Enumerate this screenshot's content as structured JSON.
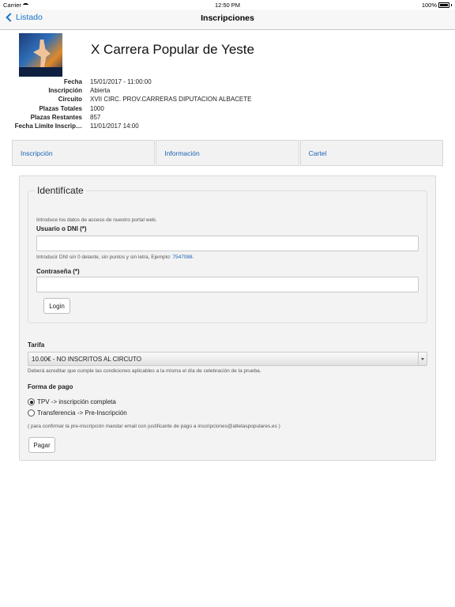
{
  "status_bar": {
    "carrier": "Carrier",
    "time": "12:50 PM",
    "battery": "100%",
    "battery_level": 1.0
  },
  "nav": {
    "back_label": "Listado",
    "title": "Inscripciones"
  },
  "race": {
    "title": "X Carrera Popular de Yeste",
    "details": [
      {
        "key": "Fecha",
        "value": "15/01/2017 - 11:00:00"
      },
      {
        "key": "Inscripción",
        "value": "Abierta"
      },
      {
        "key": "Circuito",
        "value": "XVII CIRC. PROV.CARRERAS DIPUTACION ALBACETE"
      },
      {
        "key": "Plazas Totales",
        "value": "1000"
      },
      {
        "key": "Plazas Restantes",
        "value": "857"
      },
      {
        "key": "Fecha Límite Inscrip…",
        "value": "11/01/2017 14:00"
      }
    ]
  },
  "tabs": [
    {
      "label": "Inscripción"
    },
    {
      "label": "Información"
    },
    {
      "label": "Cartel"
    }
  ],
  "login": {
    "legend": "Identifícate",
    "intro": "Introduce los datos de acceso de nuestro portal web.",
    "user_label": "Usuario o DNI (*)",
    "user_value": "",
    "user_hint_prefix": "Introducir DNI sin 0 delante, sin puntos y sin letra, Ejemplo:",
    "user_hint_example": "7547088",
    "user_hint_suffix": ".",
    "password_label": "Contraseña (*)",
    "password_value": "",
    "login_button": "Login"
  },
  "payment": {
    "tarifa_label": "Tarifa",
    "tarifa_selected": "10.00€ - NO INSCRITOS AL CIRCUTO",
    "tarifa_note": "Deberá acreditar que cumple las condiciones aplicables a la misma el día de celebración de la prueba.",
    "forma_label": "Forma de pago",
    "options": [
      {
        "label": "TPV -> inscripción completa",
        "checked": true
      },
      {
        "label": "Transferencia -> Pre-Inscripción",
        "checked": false
      }
    ],
    "note": "( para confirmar la pre-inscripción mandar email con justificante de pago a inscripciones@atletaspopulares.es )",
    "pay_button": "Pagar"
  }
}
